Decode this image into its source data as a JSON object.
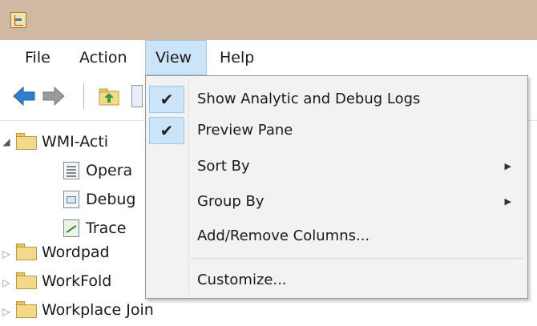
{
  "titlebar": {
    "icon": "event-viewer-app-icon"
  },
  "menubar": {
    "items": [
      {
        "label": "File"
      },
      {
        "label": "Action"
      },
      {
        "label": "View",
        "active": true
      },
      {
        "label": "Help"
      }
    ]
  },
  "toolbar": {
    "buttons": [
      "back-arrow-icon",
      "forward-arrow-icon",
      "up-folder-icon",
      "properties-icon"
    ]
  },
  "tree": {
    "items": [
      {
        "label": "WMI-Activity",
        "visible_text": "WMI-Acti",
        "icon": "folder-icon",
        "expanded": true
      },
      {
        "label": "Operational",
        "visible_text": "Opera",
        "icon": "log-icon"
      },
      {
        "label": "Debug",
        "visible_text": "Debug",
        "icon": "debug-log-icon"
      },
      {
        "label": "Trace",
        "visible_text": "Trace",
        "icon": "trace-log-icon"
      },
      {
        "label": "Wordpad",
        "visible_text": "Wordpad",
        "icon": "folder-icon",
        "expanded": false
      },
      {
        "label": "WorkFolders",
        "visible_text": "WorkFold",
        "icon": "folder-icon",
        "expanded": false
      },
      {
        "label": "Workplace Join",
        "visible_text": "Workplace Join",
        "icon": "folder-icon",
        "expanded": false
      }
    ]
  },
  "view_menu": {
    "items": [
      {
        "label": "Show Analytic and Debug Logs",
        "checked": true,
        "submenu": false
      },
      {
        "label": "Preview Pane",
        "checked": true,
        "submenu": false
      },
      {
        "label": "Sort By",
        "checked": false,
        "submenu": true
      },
      {
        "label": "Group By",
        "checked": false,
        "submenu": true
      },
      {
        "label": "Add/Remove Columns...",
        "checked": false,
        "submenu": false
      },
      {
        "label": "Customize...",
        "checked": false,
        "submenu": false
      }
    ],
    "check_glyph": "✔",
    "submenu_glyph": "▶"
  },
  "colors": {
    "titlebar": "#cfb9a2",
    "highlight": "#cce4f7",
    "highlight_border": "#99c9ef",
    "menu_bg": "#f2f2f2"
  }
}
